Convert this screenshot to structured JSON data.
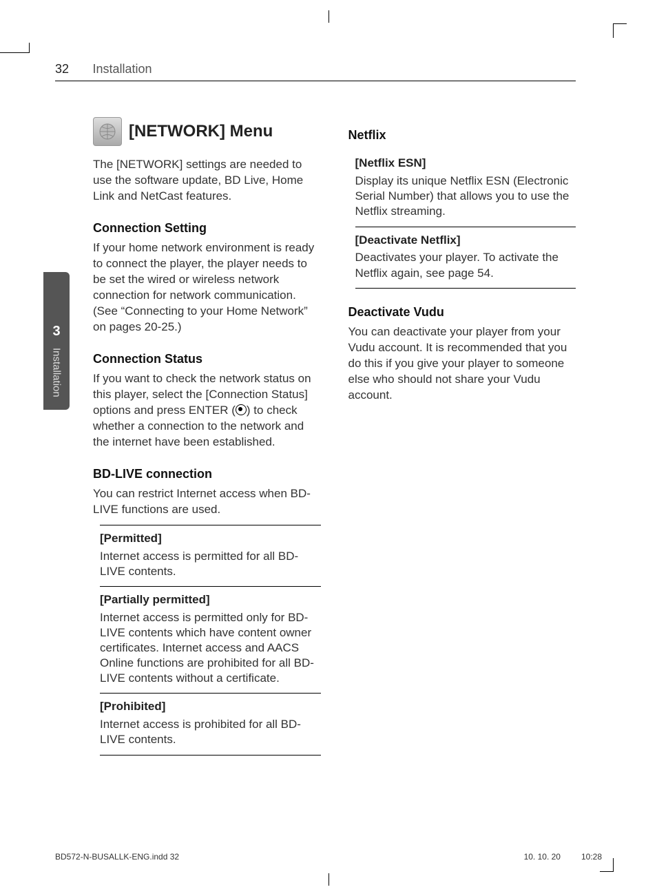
{
  "header": {
    "page_number": "32",
    "section": "Installation"
  },
  "side_tab": {
    "number": "3",
    "label": "Installation"
  },
  "col1": {
    "title": "[NETWORK] Menu",
    "intro": "The [NETWORK] settings are needed to use the software update, BD Live, Home Link and NetCast features.",
    "conn_setting_h": "Connection Setting",
    "conn_setting_p": "If your home network environment is ready to connect the player, the player needs to be set the wired or wireless network connection for network communication. (See “Connecting to your Home Network” on pages 20-25.)",
    "conn_status_h": "Connection Status",
    "conn_status_p1": "If you want to check the network status on this player, select the [Connection Status] options and press ENTER (",
    "conn_status_p2": ") to check whether a connection to the network and the internet have been established.",
    "bdlive_h": "BD-LIVE connection",
    "bdlive_p": "You can restrict Internet access when BD-LIVE functions are used.",
    "opts": [
      {
        "title": "[Permitted]",
        "body": "Internet access is permitted for all BD-LIVE contents."
      },
      {
        "title": "[Partially permitted]",
        "body": "Internet access is permitted only for BD-LIVE contents which have content owner certificates. Internet access and AACS Online functions are prohibited for all BD-LIVE contents without a certificate."
      },
      {
        "title": "[Prohibited]",
        "body": "Internet access is prohibited for all BD-LIVE contents."
      }
    ]
  },
  "col2": {
    "netflix_h": "Netflix",
    "netflix_opts": [
      {
        "title": "[Netflix ESN]",
        "body": "Display its unique Netflix ESN (Electronic Serial Number) that allows you to use the Netflix streaming."
      },
      {
        "title": "[Deactivate Netflix]",
        "body": "Deactivates your player. To activate the Netflix again, see page 54."
      }
    ],
    "vudu_h": "Deactivate Vudu",
    "vudu_p": "You can deactivate your player from your Vudu account. It is recommended that you do this if you give your player to someone else who should not share your Vudu account."
  },
  "footer": {
    "file": "BD572-N-BUSALLK-ENG.indd   32",
    "date": "10. 10. 20",
    "time": "10:28"
  }
}
